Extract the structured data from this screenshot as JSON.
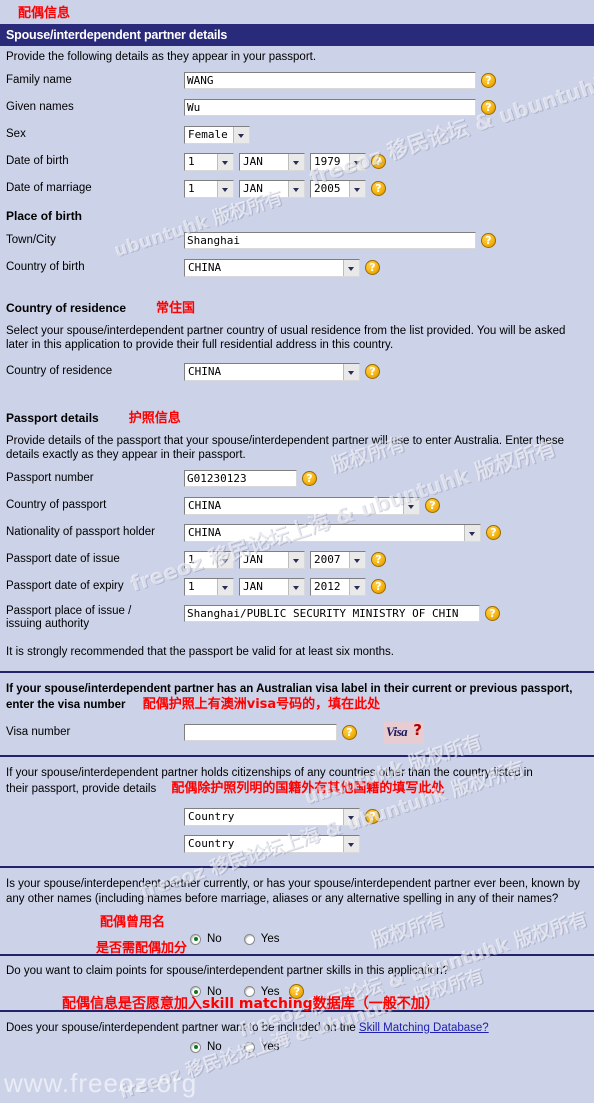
{
  "annotations": {
    "top": "配偶信息",
    "country_of_residence": "常住国",
    "passport_details": "护照信息",
    "visa_number": "配偶护照上有澳洲visa号码的，填在此处",
    "other_citizenship": "配偶除护照列明的国籍外有其他国籍的填写此处",
    "other_names": "配偶曾用名",
    "claim_points": "是否需配偶加分",
    "skill_matching": "配偶信息是否愿意加入skill matching数据库（一般不加）"
  },
  "header": {
    "title": "Spouse/interdependent partner details"
  },
  "intro": {
    "text": "Provide the following details as they appear in your passport."
  },
  "fields": {
    "family_name": {
      "label": "Family name",
      "value": "WANG"
    },
    "given_names": {
      "label": "Given names",
      "value": "Wu"
    },
    "sex": {
      "label": "Sex",
      "value": "Female"
    },
    "date_of_birth": {
      "label": "Date of birth",
      "day": "1",
      "month": "JAN",
      "year": "1979"
    },
    "date_of_marriage": {
      "label": "Date of marriage",
      "day": "1",
      "month": "JAN",
      "year": "2005"
    }
  },
  "place_of_birth": {
    "heading": "Place of birth",
    "town_label": "Town/City",
    "town_value": "Shanghai",
    "country_label": "Country of birth",
    "country_value": "CHINA"
  },
  "residence": {
    "heading": "Country of residence",
    "description": "Select your spouse/interdependent partner country of usual residence from the list provided. You will be asked later in this application to provide their full residential address in this country.",
    "label": "Country of residence",
    "value": "CHINA"
  },
  "passport": {
    "heading": "Passport details",
    "description": "Provide details of the passport that your spouse/interdependent partner will use to enter Australia. Enter these details exactly as they appear in their passport.",
    "number_label": "Passport number",
    "number_value": "G01230123",
    "country_label": "Country of passport",
    "country_value": "CHINA",
    "nationality_label": "Nationality of passport holder",
    "nationality_value": "CHINA",
    "issue_label": "Passport date of issue",
    "issue_day": "1",
    "issue_month": "JAN",
    "issue_year": "2007",
    "expiry_label": "Passport date of expiry",
    "expiry_day": "1",
    "expiry_month": "JAN",
    "expiry_year": "2012",
    "place_label_line1": "Passport place of issue /",
    "place_label_line2": "issuing authority",
    "place_value": "Shanghai/PUBLIC SECURITY MINISTRY OF CHIN",
    "recommendation": "It is strongly recommended that the passport be valid for at least six months."
  },
  "visa": {
    "question_line1": "If your spouse/interdependent partner has an Australian visa label in their current or previous passport,",
    "question_line2": "enter the visa number",
    "label": "Visa number",
    "value": "",
    "logo_text": "Visa",
    "logo_mark": "?"
  },
  "citizenship": {
    "question_line1": "If your spouse/interdependent partner holds citizenships of any countries other than the country listed in",
    "question_line2": "their passport, provide details",
    "option1": "Country",
    "option2": "Country"
  },
  "other_names": {
    "question": "Is your spouse/interdependent partner currently, or has your spouse/interdependent partner ever been, known by any other names (including names before marriage, aliases or any alternative spelling in any of their names?",
    "no": "No",
    "yes": "Yes",
    "selected": "No"
  },
  "claim_points": {
    "question": "Do you want to claim points for spouse/interdependent partner skills in this application?",
    "no": "No",
    "yes": "Yes",
    "selected": "No"
  },
  "skill_matching": {
    "question_prefix": "Does your spouse/interdependent partner want to be included on the ",
    "link_text": "Skill Matching Database?",
    "no": "No",
    "yes": "Yes",
    "selected": "No"
  },
  "icons": {
    "help": "?"
  },
  "watermarks": {
    "site": "www.freeoz.org",
    "diag1": "freeoz 移民论坛 & ubuntuhk 版权所有",
    "diag2": "freeoz 移民论坛上海 & ubuntuhk 版权所有",
    "diag3": "freeoz 移民论坛上海 & ubuntuhk 版权所有",
    "diag4": "ubuntuhk 版权所有",
    "diag5": "版权所有"
  },
  "colors": {
    "background": "#ccd2e8",
    "titlebar": "#2a2a7a",
    "annotation": "#ff0000",
    "divider": "#23236b",
    "link": "#2020b0",
    "help_icon": "#f6b511"
  }
}
